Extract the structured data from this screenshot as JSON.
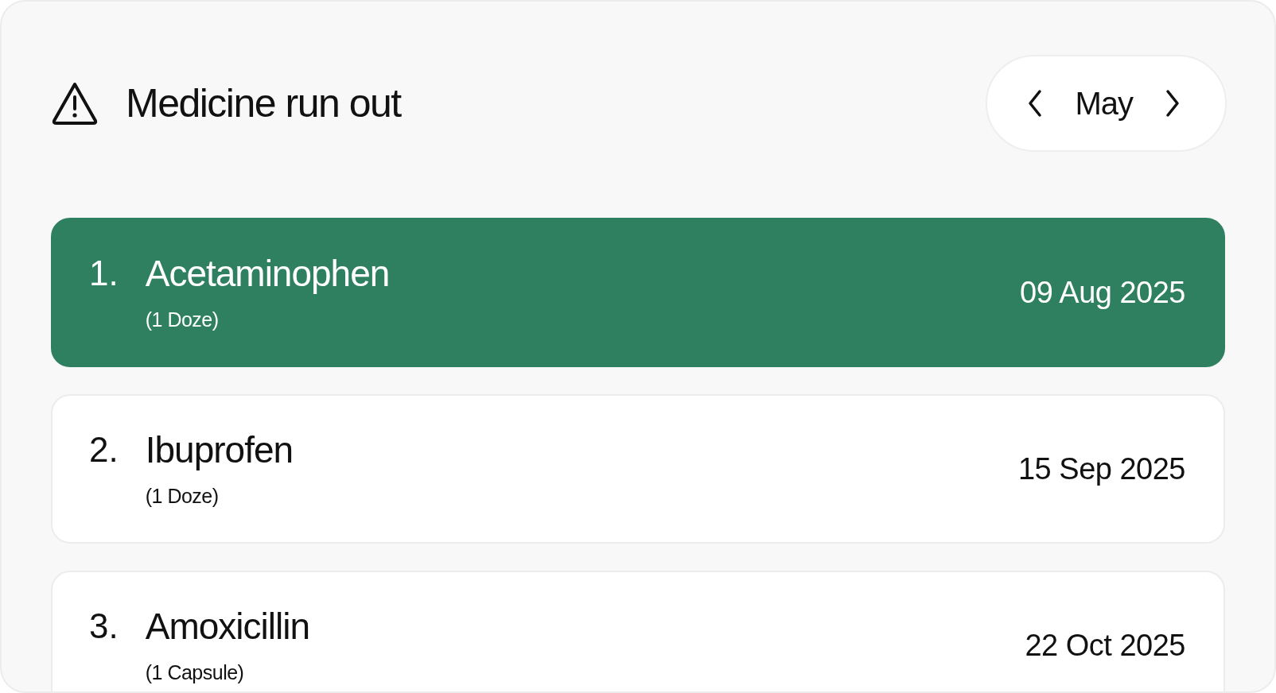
{
  "header": {
    "title": "Medicine run out",
    "month": "May"
  },
  "items": [
    {
      "number": "1.",
      "name": "Acetaminophen",
      "dose": "(1 Doze)",
      "date": "09 Aug 2025",
      "selected": true
    },
    {
      "number": "2.",
      "name": "Ibuprofen",
      "dose": "(1 Doze)",
      "date": "15 Sep 2025",
      "selected": false
    },
    {
      "number": "3.",
      "name": "Amoxicillin",
      "dose": "(1 Capsule)",
      "date": "22 Oct 2025",
      "selected": false
    }
  ]
}
